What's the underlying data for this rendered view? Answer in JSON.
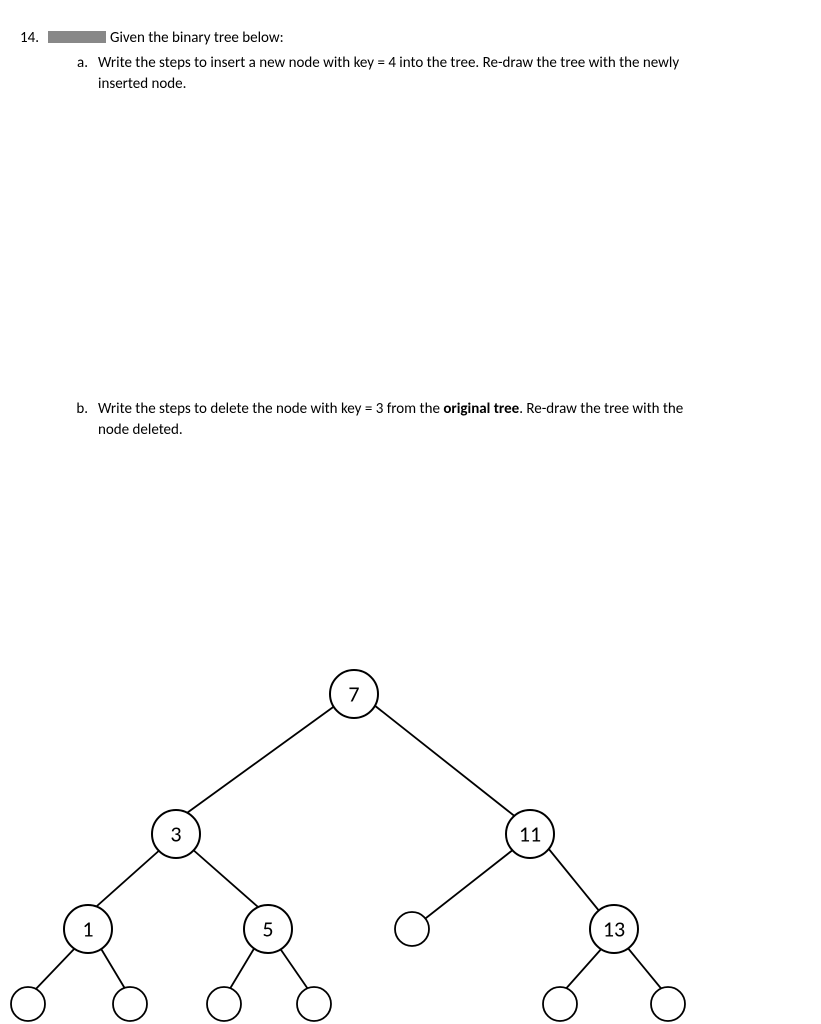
{
  "question": {
    "number": "14.",
    "intro": "Given the binary tree below:",
    "parts": {
      "a": {
        "label": "a.",
        "text_1": "Write the steps to insert a new node with key = 4 into the tree.  Re-draw the tree with the newly",
        "text_2": "inserted node."
      },
      "b": {
        "label": "b.",
        "text_1": "Write the steps to delete the node with key = 3 from the ",
        "bold": "original tree",
        "text_2": ".  Re-draw the tree with the",
        "text_3": "node deleted."
      }
    }
  },
  "tree": {
    "root": "7",
    "n3": "3",
    "n11": "11",
    "n1": "1",
    "n5": "5",
    "n13": "13"
  }
}
